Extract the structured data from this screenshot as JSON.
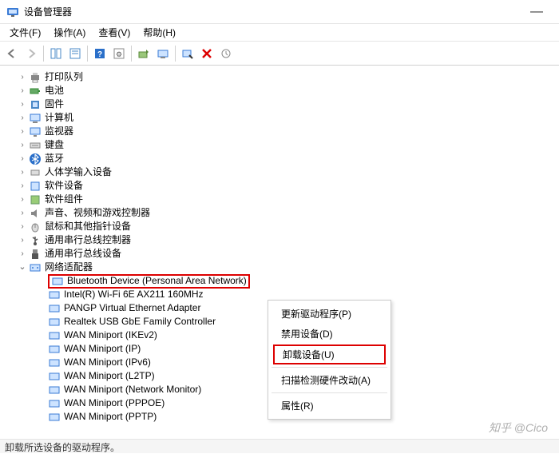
{
  "title": "设备管理器",
  "menu": {
    "file": "文件(F)",
    "action": "操作(A)",
    "view": "查看(V)",
    "help": "帮助(H)"
  },
  "tree": {
    "print_queue": "打印队列",
    "battery": "电池",
    "firmware": "固件",
    "computer": "计算机",
    "monitor": "监视器",
    "keyboard": "键盘",
    "bluetooth": "蓝牙",
    "hid": "人体学输入设备",
    "software_devices": "软件设备",
    "software_components": "软件组件",
    "audio": "声音、视频和游戏控制器",
    "mouse": "鼠标和其他指针设备",
    "usb_controllers": "通用串行总线控制器",
    "usb_devices": "通用串行总线设备",
    "network": "网络适配器",
    "net": {
      "bt": "Bluetooth Device (Personal Area Network)",
      "wifi": "Intel(R) Wi-Fi 6E AX211 160MHz",
      "pangp": "PANGP Virtual Ethernet Adapter",
      "realtek": "Realtek USB GbE Family Controller",
      "wan_ikev2": "WAN Miniport (IKEv2)",
      "wan_ip": "WAN Miniport (IP)",
      "wan_ipv6": "WAN Miniport (IPv6)",
      "wan_l2tp": "WAN Miniport (L2TP)",
      "wan_netmon": "WAN Miniport (Network Monitor)",
      "wan_pppoe": "WAN Miniport (PPPOE)",
      "wan_pptp": "WAN Miniport (PPTP)"
    }
  },
  "context": {
    "update": "更新驱动程序(P)",
    "disable": "禁用设备(D)",
    "uninstall": "卸载设备(U)",
    "scan": "扫描检测硬件改动(A)",
    "properties": "属性(R)"
  },
  "status": "卸载所选设备的驱动程序。",
  "watermark": "知乎 @Cico"
}
